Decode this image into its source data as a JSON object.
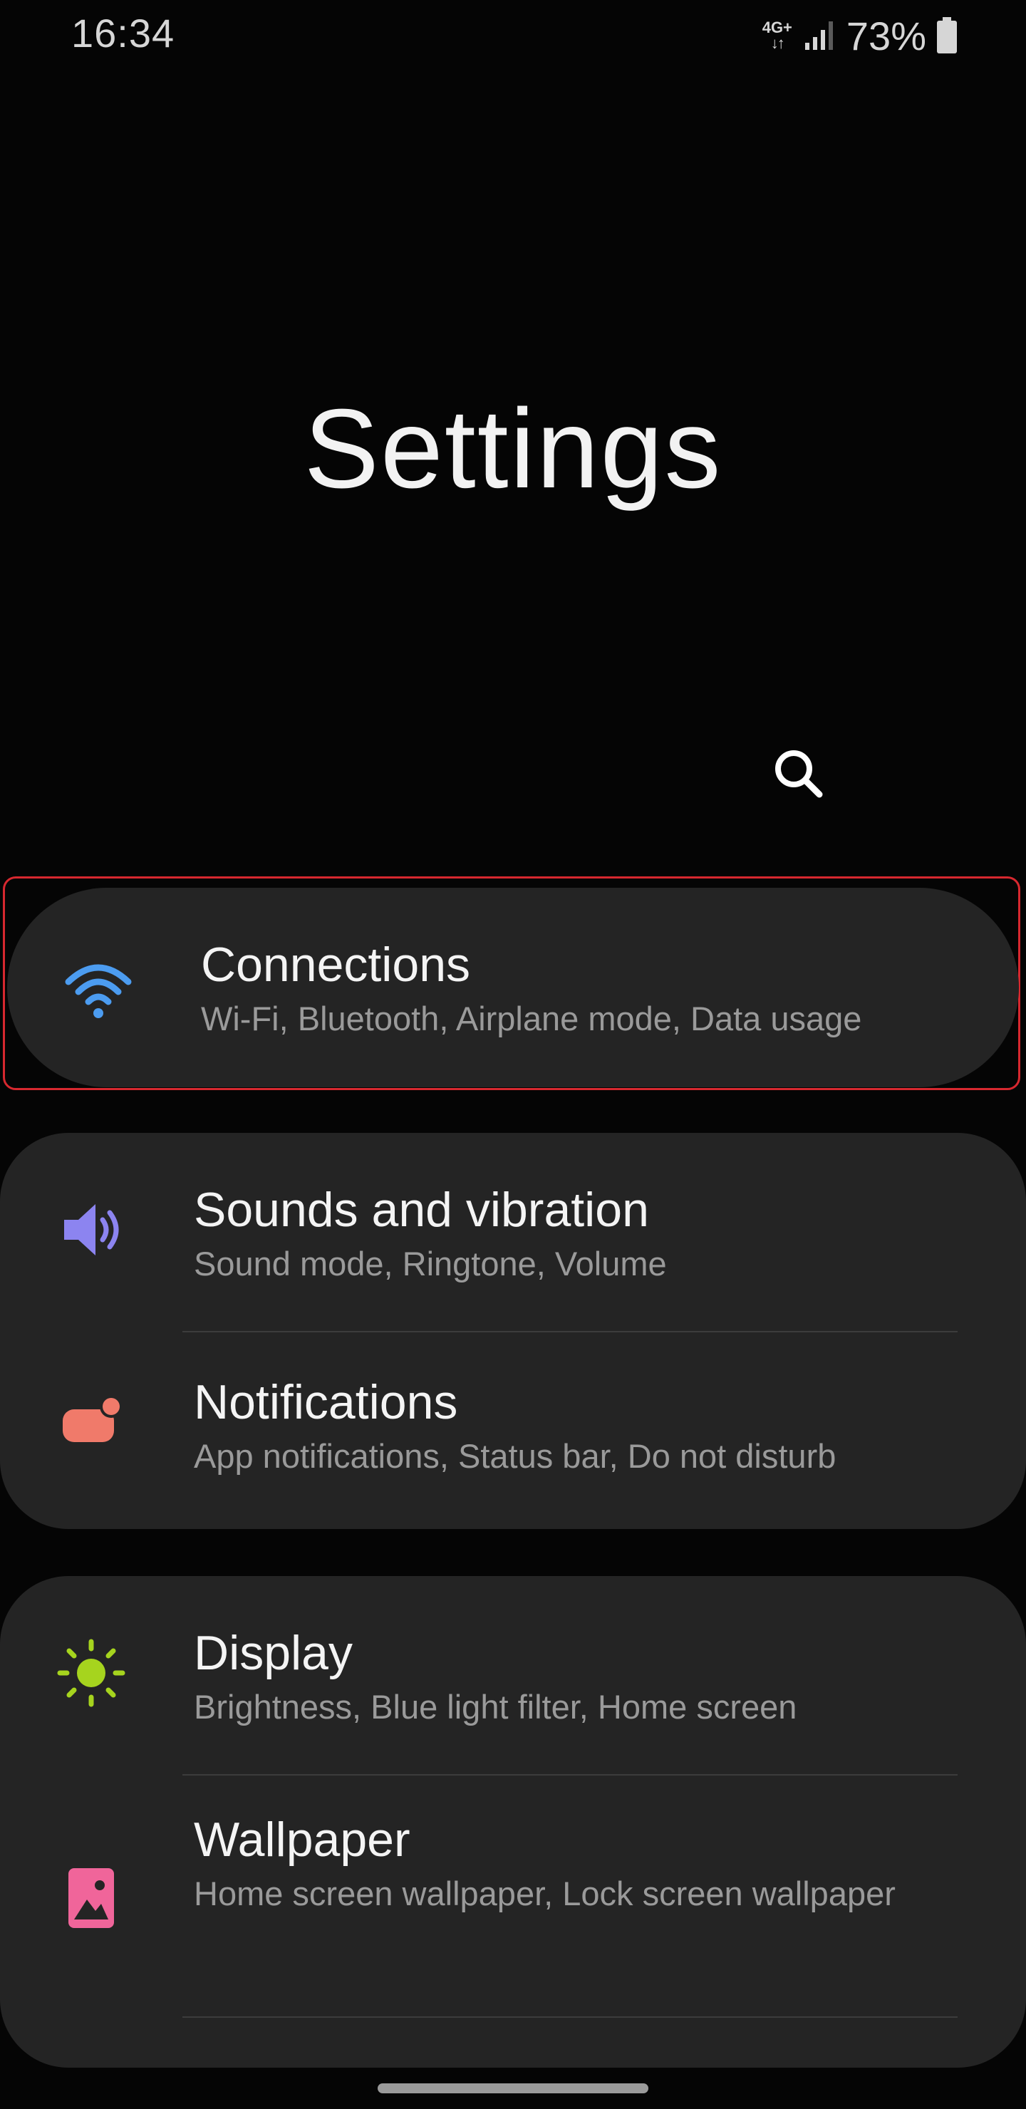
{
  "status_bar": {
    "time": "16:34",
    "network_type": "4G+",
    "battery_percent": "73%",
    "signal_level": 0.75,
    "battery_level": 0.73
  },
  "page": {
    "title": "Settings"
  },
  "search": {
    "icon": "search-icon"
  },
  "items": [
    {
      "title": "Connections",
      "subtitle": "Wi-Fi, Bluetooth, Airplane mode, Data usage",
      "icon": "wifi-icon",
      "color": "#4c9cf0"
    },
    {
      "title": "Sounds and vibration",
      "subtitle": "Sound mode, Ringtone, Volume",
      "icon": "speaker-icon",
      "color": "#8c84f0"
    },
    {
      "title": "Notifications",
      "subtitle": "App notifications, Status bar, Do not disturb",
      "icon": "notification-icon",
      "color": "#f07a6a"
    },
    {
      "title": "Display",
      "subtitle": "Brightness, Blue light filter, Home screen",
      "icon": "sun-icon",
      "color": "#a6d41e"
    },
    {
      "title": "Wallpaper",
      "subtitle": "Home screen wallpaper, Lock screen wallpaper",
      "icon": "wallpaper-icon",
      "color": "#f0659a"
    }
  ]
}
